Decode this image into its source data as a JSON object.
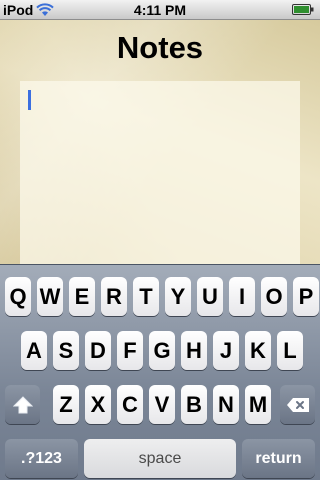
{
  "status_bar": {
    "carrier": "iPod",
    "time": "4:11 PM",
    "wifi_icon": "wifi-icon",
    "battery_icon": "battery-icon"
  },
  "note": {
    "title": "Notes",
    "body": ""
  },
  "keyboard": {
    "row1": [
      "Q",
      "W",
      "E",
      "R",
      "T",
      "Y",
      "U",
      "I",
      "O",
      "P"
    ],
    "row2": [
      "A",
      "S",
      "D",
      "F",
      "G",
      "H",
      "J",
      "K",
      "L"
    ],
    "row3": [
      "Z",
      "X",
      "C",
      "V",
      "B",
      "N",
      "M"
    ],
    "shift_icon": "shift-icon",
    "backspace_icon": "backspace-icon",
    "numbers_label": ".?123",
    "space_label": "space",
    "return_label": "return"
  },
  "colors": {
    "cursor": "#3b6fe0",
    "keyboard_bg": "#7a8596",
    "key_light": "#ffffff",
    "key_dark": "#6b7586"
  }
}
